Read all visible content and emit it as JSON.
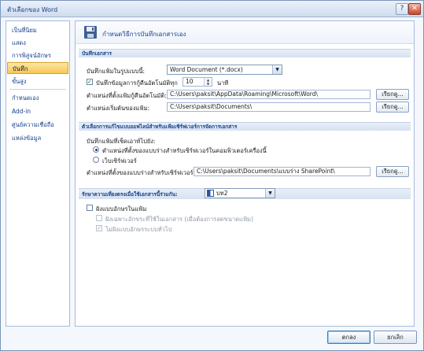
{
  "window": {
    "title": "ตัวเลือกของ Word"
  },
  "titlebar_buttons": {
    "help": "?",
    "close": "✕"
  },
  "sidebar": {
    "items": [
      {
        "label": "เป็นที่นิยม"
      },
      {
        "label": "แสดง"
      },
      {
        "label": "การพิสูจน์อักษร"
      },
      {
        "label": "บันทึก"
      },
      {
        "label": "ขั้นสูง"
      },
      {
        "label": "กำหนดเอง"
      },
      {
        "label": "Add-in"
      },
      {
        "label": "ศูนย์ความเชื่อถือ"
      },
      {
        "label": "แหล่งข้อมูล"
      }
    ],
    "active_index": 3
  },
  "header": {
    "title": "กำหนดวิธีการบันทึกเอกสารเอง"
  },
  "save_documents": {
    "heading": "บันทึกเอกสาร",
    "format_label": "บันทึกแฟ้มในรูปแบบนี้:",
    "format_value": "Word Document (*.docx)",
    "autorecover_label": "บันทึกข้อมูลการกู้คืนอัตโนมัติทุก",
    "autorecover_checked": "✓",
    "autorecover_minutes": "10",
    "minutes_unit": "นาที",
    "autorecover_location_label": "ตำแหน่งที่ตั้งแฟ้มกู้คืนอัตโนมัติ:",
    "autorecover_location_value": "C:\\Users\\paksit\\AppData\\Roaming\\Microsoft\\Word\\",
    "default_location_label": "ตำแหน่งเริ่มต้นของแฟ้ม:",
    "default_location_value": "C:\\Users\\paksit\\Documents\\",
    "browse_label": "เรียกดู..."
  },
  "offline_editing": {
    "heading": "ตัวเลือกการแก้ไขแบบออฟไลน์สำหรับแฟ้มเซิร์ฟเวอร์การจัดการเอกสาร",
    "save_to_label": "บันทึกแฟ้มที่เช็คเอาท์ไปยัง:",
    "option_local": "ตำแหน่งที่ตั้งของแบบร่างสำหรับเซิร์ฟเวอร์ในคอมพิวเตอร์เครื่องนี้",
    "option_server": "เว็บเซิร์ฟเวอร์",
    "drafts_label": "ตำแหน่งที่ตั้งของแบบร่างสำหรับเซิร์ฟเวอร์:",
    "drafts_value": "C:\\Users\\paksit\\Documents\\แบบร่าง SharePoint\\",
    "browse_label": "เรียกดู..."
  },
  "fidelity": {
    "heading": "รักษาความเที่ยงตรงเมื่อใช้เอกสารนี้ร่วมกัน:",
    "document_value": "บท2",
    "embed_fonts_label": "ฝังแบบอักษรในแฟ้ม",
    "embed_used_only_label": "ฝังเฉพาะอักขระที่ใช้ในเอกสาร (เมื่อต้องการลดขนาดแฟ้ม)",
    "no_common_fonts_label": "ไม่ฝังแบบอักษรระบบทั่วไป",
    "no_common_fonts_checked": "✓"
  },
  "footer": {
    "ok": "ตกลง",
    "cancel": "ยกเลิก"
  }
}
